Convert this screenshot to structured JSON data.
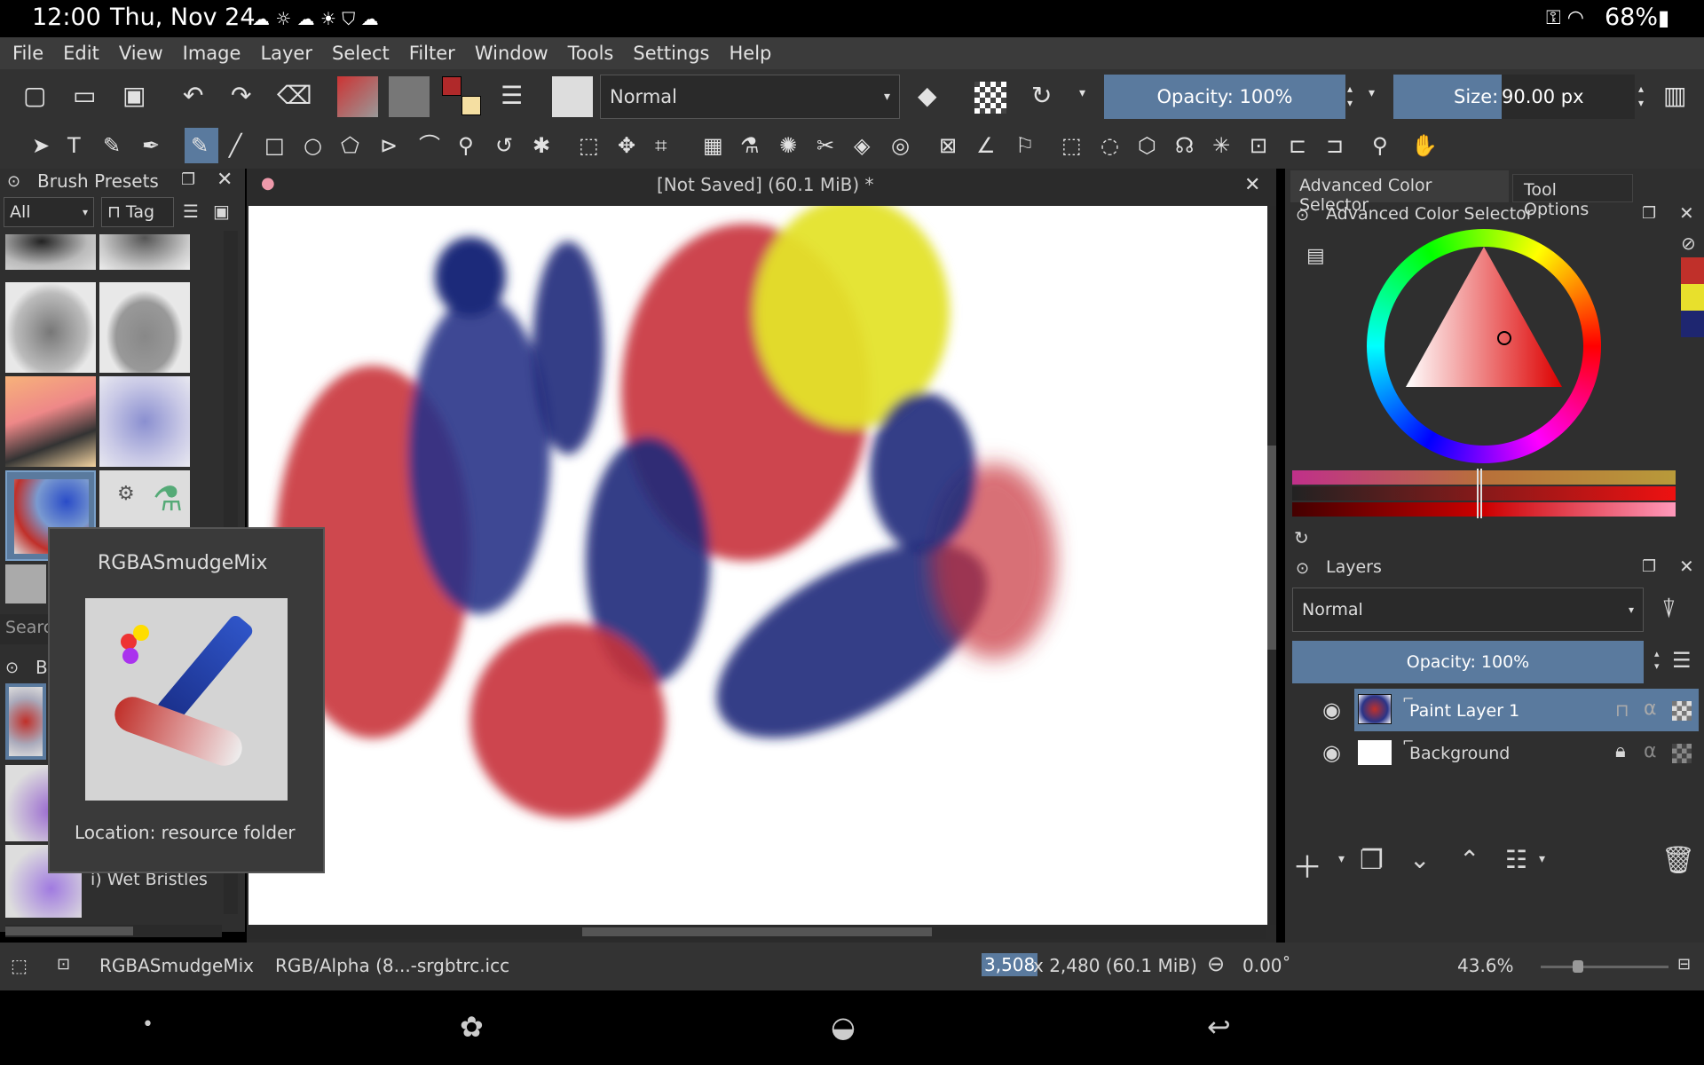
{
  "status_bar": {
    "time": "12:00",
    "date": "Thu, Nov 24",
    "battery": "68%"
  },
  "menu": [
    "File",
    "Edit",
    "View",
    "Image",
    "Layer",
    "Select",
    "Filter",
    "Window",
    "Tools",
    "Settings",
    "Help"
  ],
  "toolbar": {
    "blend_mode": "Normal",
    "opacity_label": "Opacity: 100%",
    "size_label": "Size:",
    "size_value": "90.00 px"
  },
  "brush_presets": {
    "title": "Brush Presets",
    "filter": "All",
    "tag_label": "Tag",
    "search_placeholder": "Searc",
    "second_docker_letter": "B",
    "list_item": "i) Wet Bristles"
  },
  "tooltip": {
    "name": "RGBASmudgeMix",
    "location": "Location: resource folder"
  },
  "document": {
    "title": "[Not Saved]  (60.1 MiB)  *"
  },
  "right_dock": {
    "tab_color": "Advanced Color Selector",
    "tab_tool": "Tool Options",
    "color_panel_title": "Advanced Color Selector",
    "layers_title": "Layers",
    "layers_blend": "Normal",
    "layers_opacity": "Opacity:  100%",
    "layers": [
      {
        "name": "Paint Layer 1",
        "selected": true
      },
      {
        "name": "Background",
        "selected": false
      }
    ]
  },
  "bottom_status": {
    "brush": "RGBASmudgeMix",
    "colorspace": "RGB/Alpha (8...-srgbtrc.icc",
    "size_sel": "3,508",
    "size_rest": " x 2,480 (60.1 MiB)",
    "rotation": "0.00˚",
    "zoom": "43.6%"
  },
  "colors": {
    "fg": "#c0302a",
    "accent": "#5a7a9e",
    "selected_layer": "#5a7a9e"
  }
}
